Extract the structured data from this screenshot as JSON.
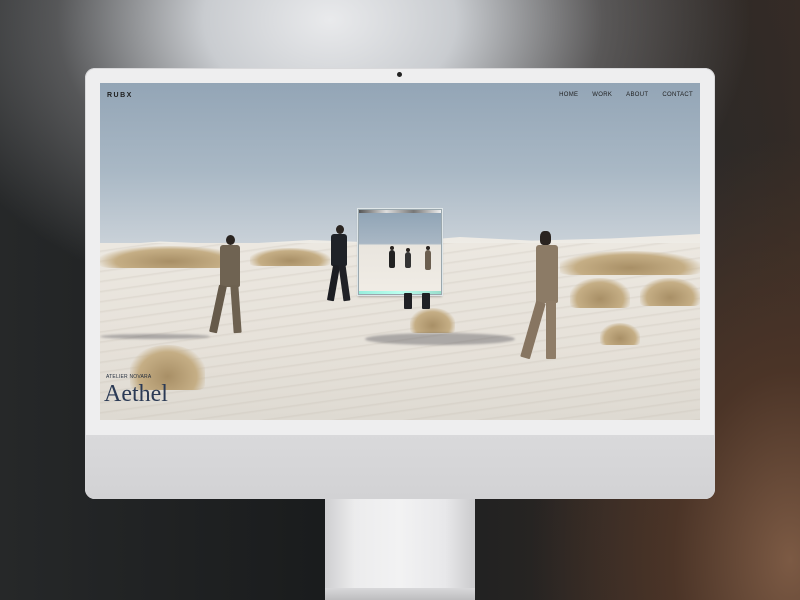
{
  "site": {
    "logo": "RUBX",
    "nav": [
      "HOME",
      "WORK",
      "ABOUT",
      "CONTACT"
    ]
  },
  "hero": {
    "subtitle": "ATELIER NOVARA",
    "title": "Aethel"
  },
  "icons": {
    "camera": "camera-dot-icon"
  },
  "colors": {
    "title": "#2b3a55",
    "nav_text": "#1e1e1e",
    "sky": "#9fb0c0",
    "sand": "#e8e3db"
  }
}
